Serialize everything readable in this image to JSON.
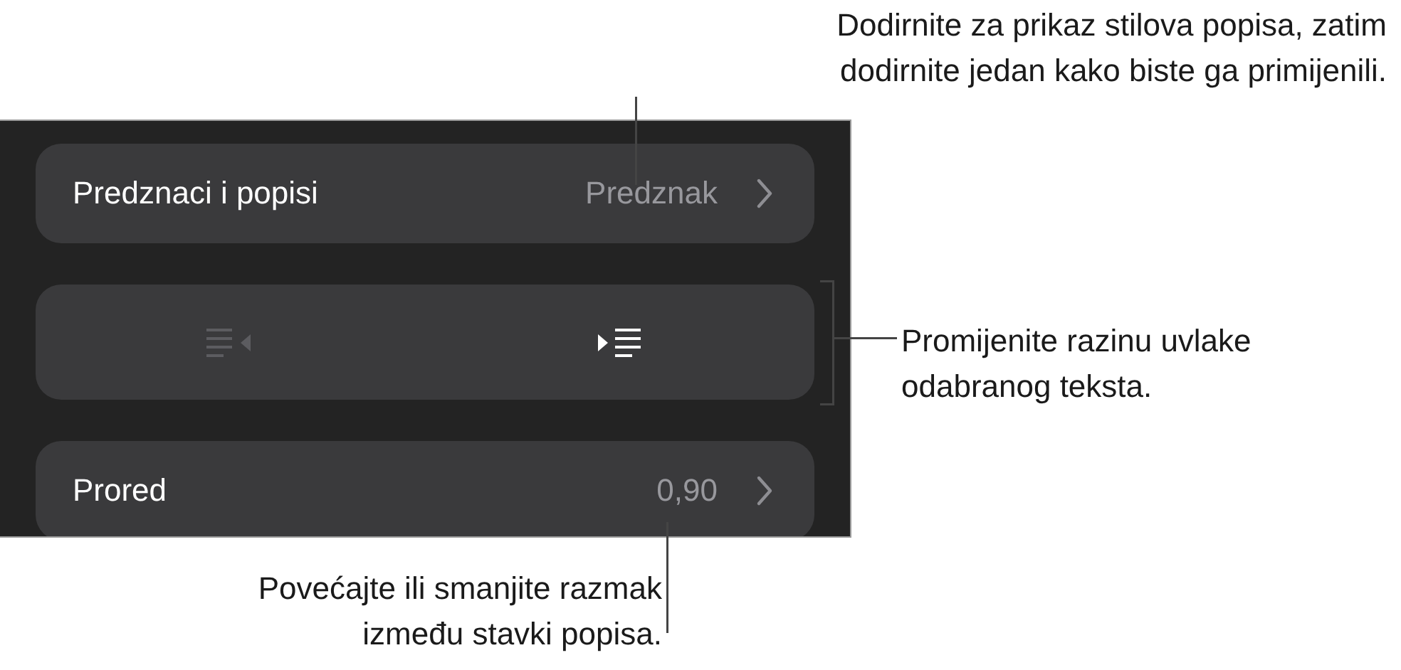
{
  "panel": {
    "rows": [
      {
        "kind": "nav",
        "label": "Predznaci i popisi",
        "value": "Predznak"
      },
      {
        "kind": "indent",
        "buttons": [
          {
            "kind": "decrease",
            "disabled": true
          },
          {
            "kind": "increase",
            "disabled": false
          }
        ]
      },
      {
        "kind": "nav",
        "label": "Prored",
        "value": "0,90"
      }
    ]
  },
  "callouts": [
    {
      "kind": "top",
      "lines": [
        "Dodirnite za prikaz stilova popisa, zatim",
        "dodirnite jedan kako biste ga primijenili."
      ]
    },
    {
      "kind": "right",
      "lines": [
        "Promijenite razinu uvlake",
        "odabranog teksta."
      ]
    },
    {
      "kind": "bottom",
      "lines": [
        "Povećajte ili smanjite razmak",
        "između stavki popisa."
      ]
    }
  ]
}
